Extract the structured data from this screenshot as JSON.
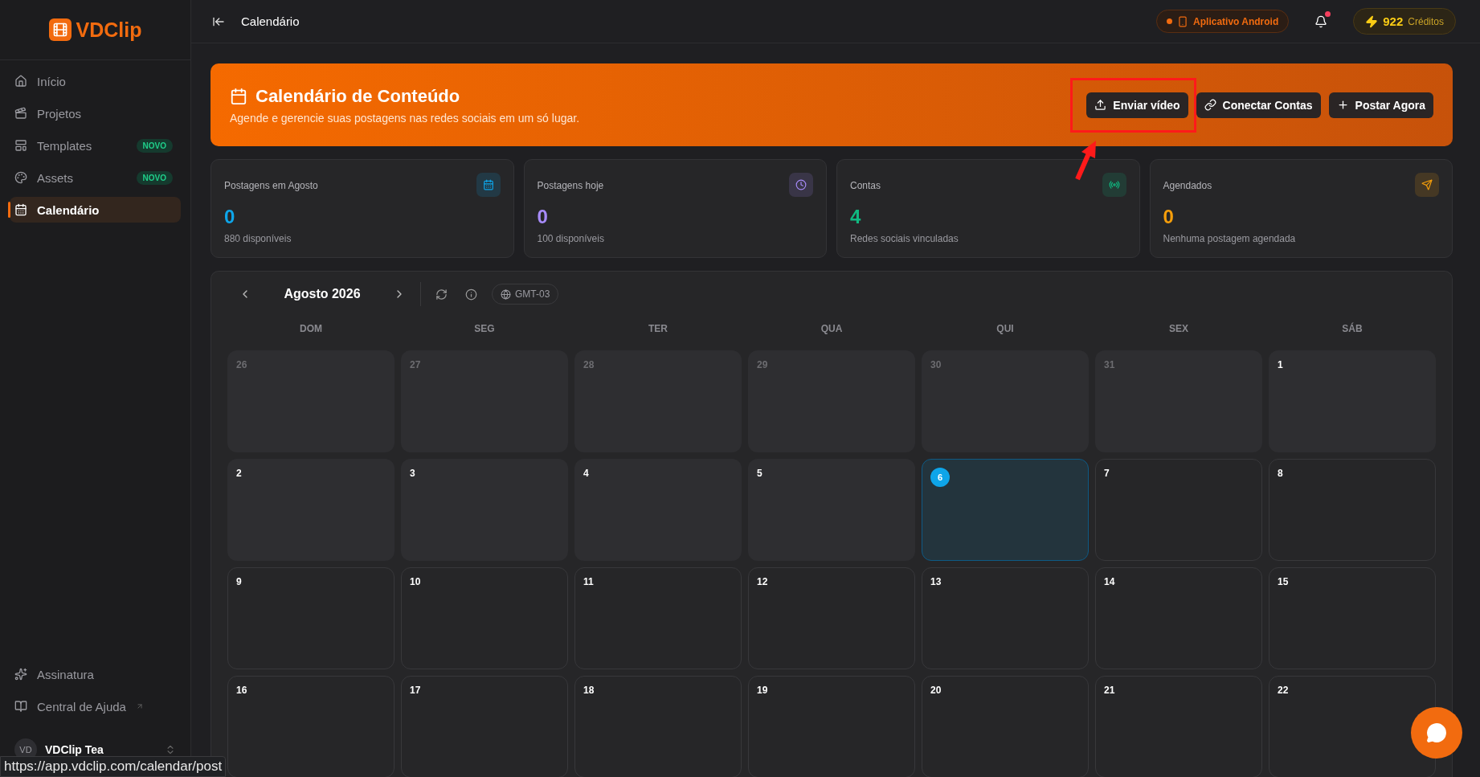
{
  "sidebar": {
    "logo": "VDClip",
    "items": [
      {
        "label": "Início",
        "selected": false
      },
      {
        "label": "Projetos",
        "selected": false
      },
      {
        "label": "Templates",
        "badge": "NOVO",
        "selected": false
      },
      {
        "label": "Assets",
        "badge": "NOVO",
        "selected": false
      },
      {
        "label": "Calendário",
        "selected": true
      }
    ],
    "bottom_items": [
      {
        "label": "Assinatura"
      },
      {
        "label": "Central de Ajuda"
      }
    ],
    "user": {
      "initials": "VD",
      "name": "VDClip Tea"
    }
  },
  "topbar": {
    "title": "Calendário",
    "android_button": "Aplicativo Android",
    "notifications_unread": true,
    "credits": "922",
    "credits_label": "Créditos"
  },
  "banner": {
    "title": "Calendário de Conteúdo",
    "subtitle": "Agende e gerencie suas postagens nas redes sociais em um só lugar.",
    "buttons": [
      {
        "label": "Enviar vídeo",
        "highlighted": true
      },
      {
        "label": "Conectar Contas",
        "highlighted": false
      },
      {
        "label": "Postar Agora",
        "highlighted": false
      }
    ]
  },
  "stats": [
    {
      "label": "Postagens em Agosto",
      "value": "0",
      "note": "880 disponíveis",
      "color": "#0ea5e9"
    },
    {
      "label": "Postagens hoje",
      "value": "0",
      "note": "100 disponíveis",
      "color": "#a78bfa"
    },
    {
      "label": "Contas",
      "value": "4",
      "note": "Redes sociais vinculadas",
      "color": "#10b981"
    },
    {
      "label": "Agendados",
      "value": "0",
      "note": "Nenhuma postagem agendada",
      "color": "#f59e0b"
    }
  ],
  "calendar": {
    "month": "Agosto 2026",
    "timezone": "GMT-03",
    "weekdays": [
      "DOM",
      "SEG",
      "TER",
      "QUA",
      "QUI",
      "SEX",
      "SÁB"
    ],
    "weeks": [
      [
        {
          "day": "26",
          "kind": "other"
        },
        {
          "day": "27",
          "kind": "other"
        },
        {
          "day": "28",
          "kind": "other"
        },
        {
          "day": "29",
          "kind": "other"
        },
        {
          "day": "30",
          "kind": "other"
        },
        {
          "day": "31",
          "kind": "other"
        },
        {
          "day": "1",
          "kind": "past"
        }
      ],
      [
        {
          "day": "2",
          "kind": "past"
        },
        {
          "day": "3",
          "kind": "past"
        },
        {
          "day": "4",
          "kind": "past"
        },
        {
          "day": "5",
          "kind": "past"
        },
        {
          "day": "6",
          "kind": "today"
        },
        {
          "day": "7",
          "kind": "future"
        },
        {
          "day": "8",
          "kind": "future"
        }
      ],
      [
        {
          "day": "9",
          "kind": "future"
        },
        {
          "day": "10",
          "kind": "future"
        },
        {
          "day": "11",
          "kind": "future"
        },
        {
          "day": "12",
          "kind": "future"
        },
        {
          "day": "13",
          "kind": "future"
        },
        {
          "day": "14",
          "kind": "future"
        },
        {
          "day": "15",
          "kind": "future"
        }
      ],
      [
        {
          "day": "16",
          "kind": "future"
        },
        {
          "day": "17",
          "kind": "future"
        },
        {
          "day": "18",
          "kind": "future"
        },
        {
          "day": "19",
          "kind": "future"
        },
        {
          "day": "20",
          "kind": "future"
        },
        {
          "day": "21",
          "kind": "future"
        },
        {
          "day": "22",
          "kind": "future"
        }
      ]
    ]
  },
  "browser_status_url": "https://app.vdclip.com/calendar/post"
}
